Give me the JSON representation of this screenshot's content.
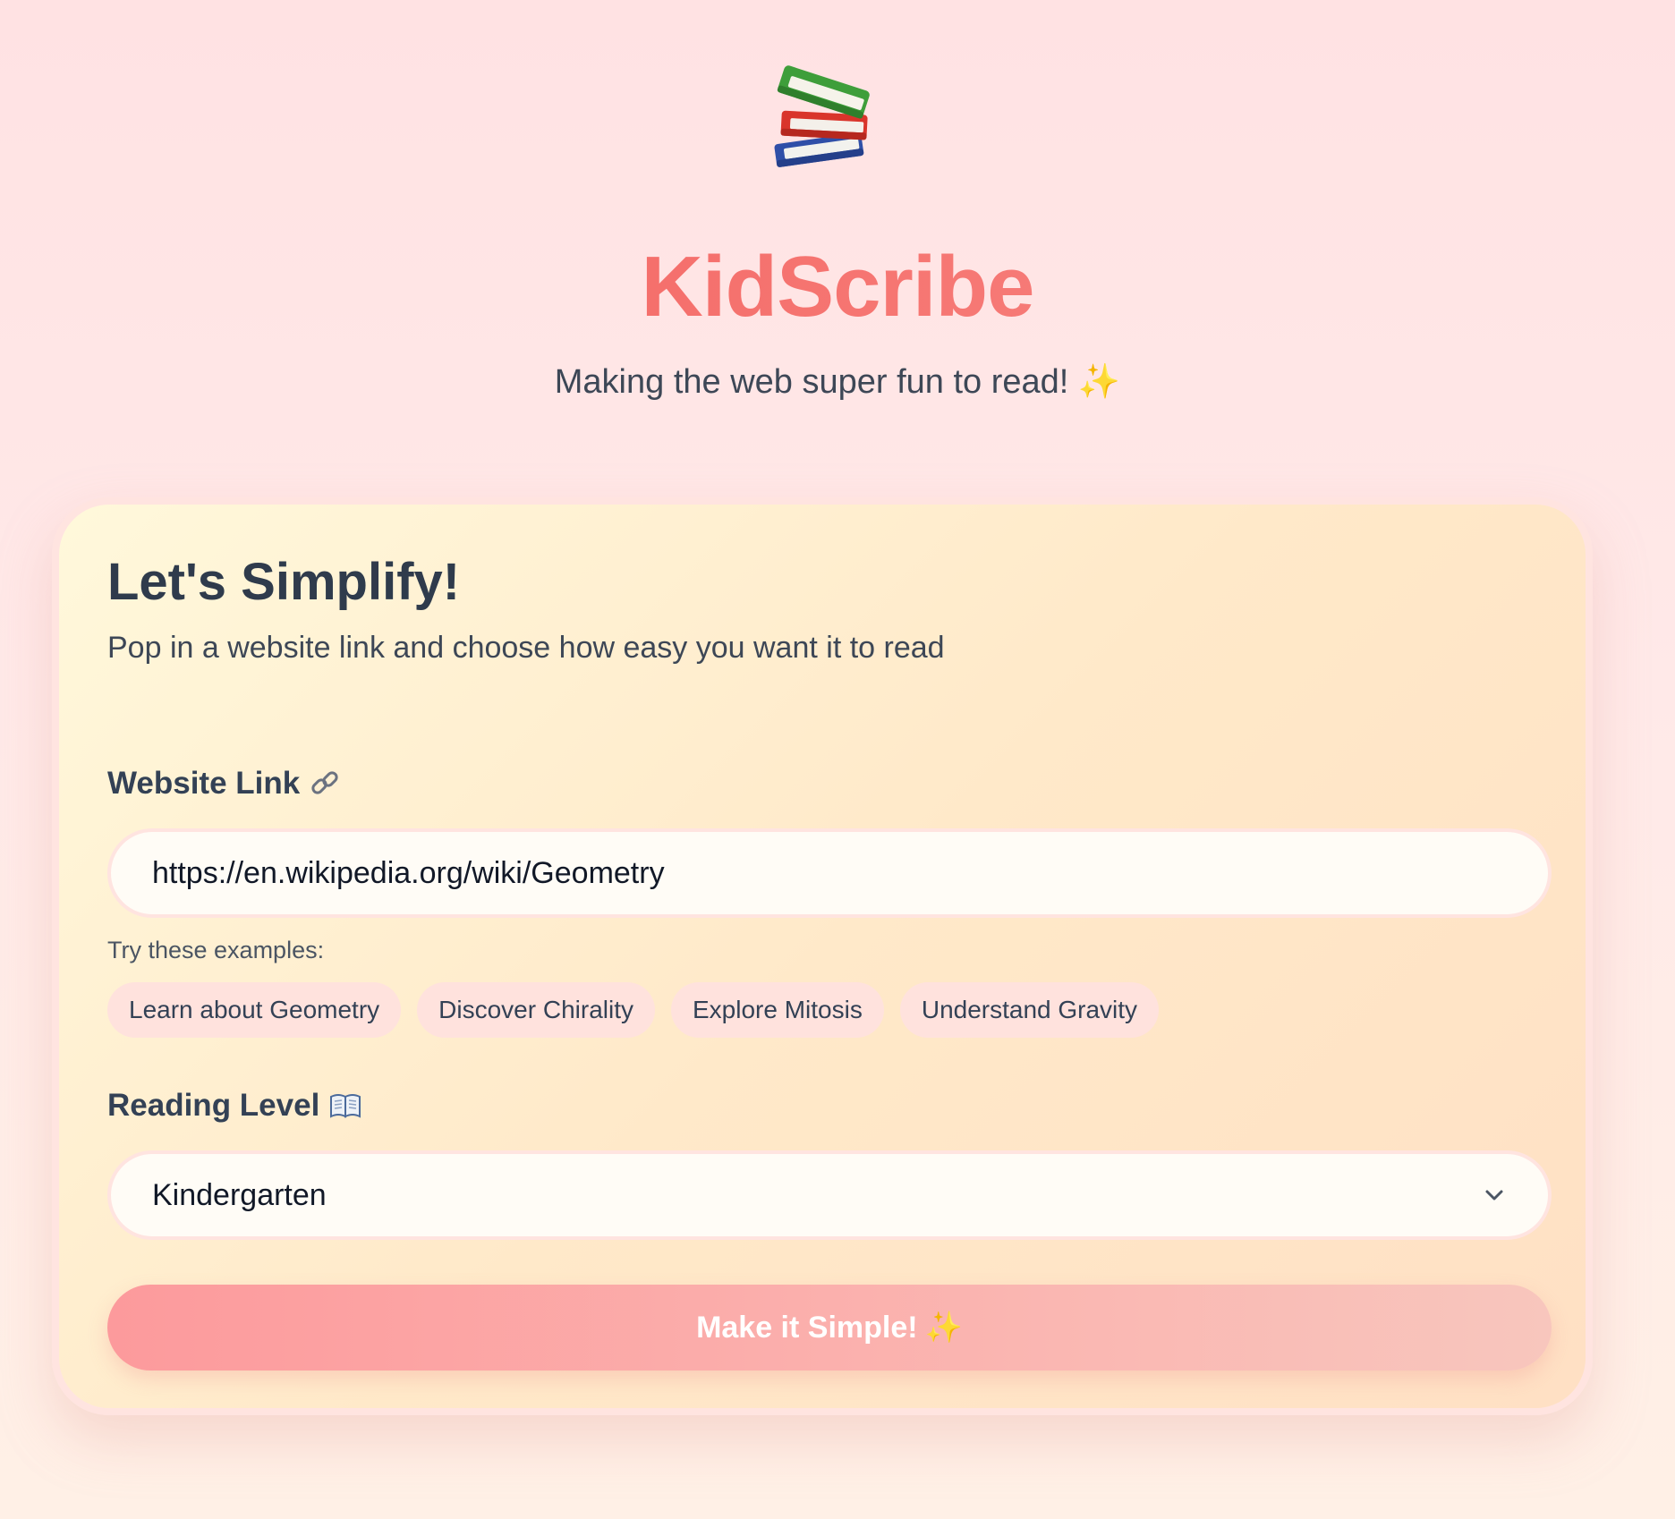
{
  "header": {
    "logo_icon": "books-stack-icon",
    "title": "KidScribe",
    "subtitle": "Making the web super fun to read!",
    "subtitle_icon": "sparkles-icon"
  },
  "card": {
    "title": "Let's Simplify!",
    "subtitle": "Pop in a website link and choose how easy you want it to read",
    "website_field": {
      "label": "Website Link",
      "label_icon": "link-icon",
      "value": "https://en.wikipedia.org/wiki/Geometry"
    },
    "examples": {
      "label": "Try these examples:",
      "items": [
        "Learn about Geometry",
        "Discover Chirality",
        "Explore Mitosis",
        "Understand Gravity"
      ]
    },
    "reading_level": {
      "label": "Reading Level",
      "label_icon": "open-book-icon",
      "selected": "Kindergarten"
    },
    "submit": {
      "label": "Make it Simple!",
      "icon": "sparkles-icon"
    }
  },
  "colors": {
    "accent": "#f87171",
    "background": "#ffe6e6",
    "card_background": "#ffefd2",
    "chip_background": "#ffe2dd",
    "button_start": "#fc9a9c",
    "button_end": "#f8c6bd"
  }
}
